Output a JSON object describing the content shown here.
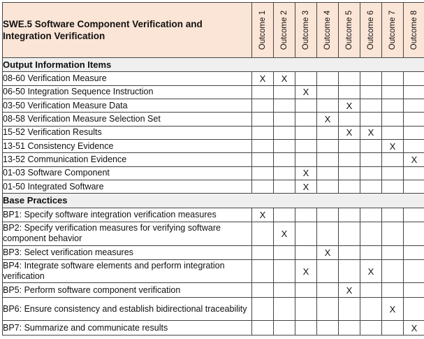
{
  "title": "SWE.5 Software Component Verification and Integration Verification",
  "outcomes": [
    "Outcome 1",
    "Outcome 2",
    "Outcome 3",
    "Outcome 4",
    "Outcome 5",
    "Outcome 6",
    "Outcome 7",
    "Outcome 8"
  ],
  "mark_symbol": "X",
  "colors": {
    "header_bg": "#fbe5d6",
    "section_bg": "#efefef",
    "title_accent": "#c00000",
    "output_accent": "#2e74b5",
    "practice_accent": "#70ad47"
  },
  "sections": [
    {
      "title": "Output Information Items",
      "kind": "wp",
      "rows": [
        {
          "label": "08-60 Verification Measure",
          "outcomes": [
            1,
            2
          ]
        },
        {
          "label": "06-50 Integration Sequence Instruction",
          "outcomes": [
            3
          ]
        },
        {
          "label": "03-50 Verification Measure Data",
          "outcomes": [
            5
          ]
        },
        {
          "label": "08-58 Verification Measure Selection Set",
          "outcomes": [
            4
          ]
        },
        {
          "label": "15-52 Verification Results",
          "outcomes": [
            5,
            6
          ]
        },
        {
          "label": "13-51 Consistency Evidence",
          "outcomes": [
            7
          ]
        },
        {
          "label": "13-52 Communication Evidence",
          "outcomes": [
            8
          ]
        },
        {
          "label": "01-03 Software Component",
          "outcomes": [
            3
          ]
        },
        {
          "label": "01-50 Integrated Software",
          "outcomes": [
            3
          ]
        }
      ]
    },
    {
      "title": "Base Practices",
      "kind": "bp",
      "rows": [
        {
          "label": "BP1: Specify software integration verification measures",
          "outcomes": [
            1
          ]
        },
        {
          "label": "BP2: Specify verification measures for verifying software component behavior",
          "outcomes": [
            2
          ]
        },
        {
          "label": "BP3: Select verification measures",
          "outcomes": [
            4
          ]
        },
        {
          "label": "BP4: Integrate software elements and perform integration verification",
          "outcomes": [
            3,
            6
          ]
        },
        {
          "label": "BP5: Perform software component verification",
          "outcomes": [
            5
          ]
        },
        {
          "label": "BP6: Ensure consistency and establish bidirectional traceability",
          "outcomes": [
            7
          ]
        },
        {
          "label": "BP7: Summarize and communicate results",
          "outcomes": [
            8
          ]
        }
      ]
    }
  ]
}
